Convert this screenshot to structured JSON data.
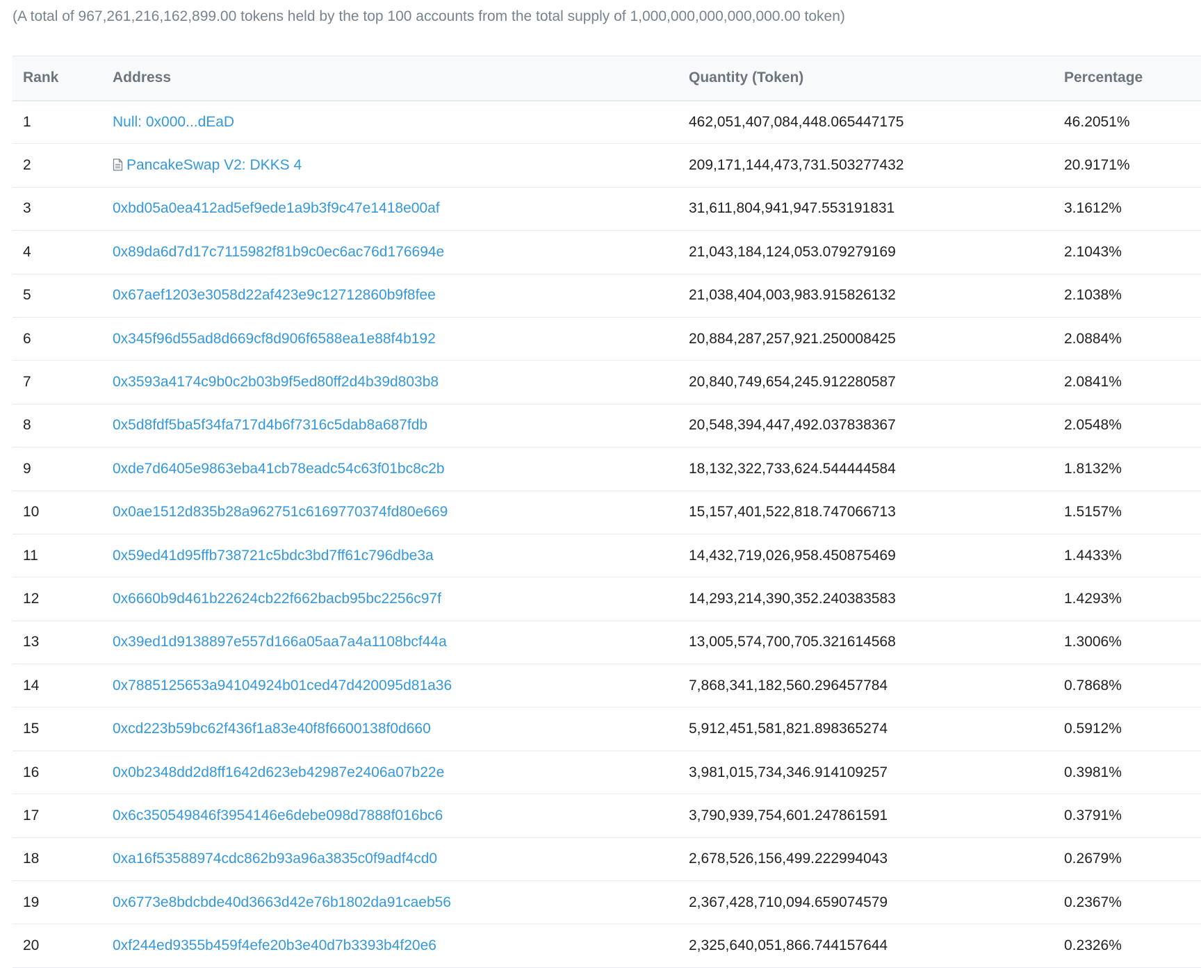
{
  "summary": "(A total of 967,261,216,162,899.00 tokens held by the top 100 accounts from the total supply of 1,000,000,000,000,000.00 token)",
  "table": {
    "headers": {
      "rank": "Rank",
      "address": "Address",
      "quantity": "Quantity (Token)",
      "percentage": "Percentage"
    },
    "rows": [
      {
        "rank": "1",
        "address": "Null: 0x000...dEaD",
        "is_contract": false,
        "quantity": "462,051,407,084,448.065447175",
        "percentage": "46.2051%"
      },
      {
        "rank": "2",
        "address": "PancakeSwap V2: DKKS 4",
        "is_contract": true,
        "icon": "contract-document-icon",
        "quantity": "209,171,144,473,731.503277432",
        "percentage": "20.9171%"
      },
      {
        "rank": "3",
        "address": "0xbd05a0ea412ad5ef9ede1a9b3f9c47e1418e00af",
        "is_contract": false,
        "quantity": "31,611,804,941,947.553191831",
        "percentage": "3.1612%"
      },
      {
        "rank": "4",
        "address": "0x89da6d7d17c7115982f81b9c0ec6ac76d176694e",
        "is_contract": false,
        "quantity": "21,043,184,124,053.079279169",
        "percentage": "2.1043%"
      },
      {
        "rank": "5",
        "address": "0x67aef1203e3058d22af423e9c12712860b9f8fee",
        "is_contract": false,
        "quantity": "21,038,404,003,983.915826132",
        "percentage": "2.1038%"
      },
      {
        "rank": "6",
        "address": "0x345f96d55ad8d669cf8d906f6588ea1e88f4b192",
        "is_contract": false,
        "quantity": "20,884,287,257,921.250008425",
        "percentage": "2.0884%"
      },
      {
        "rank": "7",
        "address": "0x3593a4174c9b0c2b03b9f5ed80ff2d4b39d803b8",
        "is_contract": false,
        "quantity": "20,840,749,654,245.912280587",
        "percentage": "2.0841%"
      },
      {
        "rank": "8",
        "address": "0x5d8fdf5ba5f34fa717d4b6f7316c5dab8a687fdb",
        "is_contract": false,
        "quantity": "20,548,394,447,492.037838367",
        "percentage": "2.0548%"
      },
      {
        "rank": "9",
        "address": "0xde7d6405e9863eba41cb78eadc54c63f01bc8c2b",
        "is_contract": false,
        "quantity": "18,132,322,733,624.544444584",
        "percentage": "1.8132%"
      },
      {
        "rank": "10",
        "address": "0x0ae1512d835b28a962751c6169770374fd80e669",
        "is_contract": false,
        "quantity": "15,157,401,522,818.747066713",
        "percentage": "1.5157%"
      },
      {
        "rank": "11",
        "address": "0x59ed41d95ffb738721c5bdc3bd7ff61c796dbe3a",
        "is_contract": false,
        "quantity": "14,432,719,026,958.450875469",
        "percentage": "1.4433%"
      },
      {
        "rank": "12",
        "address": "0x6660b9d461b22624cb22f662bacb95bc2256c97f",
        "is_contract": false,
        "quantity": "14,293,214,390,352.240383583",
        "percentage": "1.4293%"
      },
      {
        "rank": "13",
        "address": "0x39ed1d9138897e557d166a05aa7a4a1108bcf44a",
        "is_contract": false,
        "quantity": "13,005,574,700,705.321614568",
        "percentage": "1.3006%"
      },
      {
        "rank": "14",
        "address": "0x7885125653a94104924b01ced47d420095d81a36",
        "is_contract": false,
        "quantity": "7,868,341,182,560.296457784",
        "percentage": "0.7868%"
      },
      {
        "rank": "15",
        "address": "0xcd223b59bc62f436f1a83e40f8f6600138f0d660",
        "is_contract": false,
        "quantity": "5,912,451,581,821.898365274",
        "percentage": "0.5912%"
      },
      {
        "rank": "16",
        "address": "0x0b2348dd2d8ff1642d623eb42987e2406a07b22e",
        "is_contract": false,
        "quantity": "3,981,015,734,346.914109257",
        "percentage": "0.3981%"
      },
      {
        "rank": "17",
        "address": "0x6c350549846f3954146e6debe098d7888f016bc6",
        "is_contract": false,
        "quantity": "3,790,939,754,601.247861591",
        "percentage": "0.3791%"
      },
      {
        "rank": "18",
        "address": "0xa16f53588974cdc862b93a96a3835c0f9adf4cd0",
        "is_contract": false,
        "quantity": "2,678,526,156,499.222994043",
        "percentage": "0.2679%"
      },
      {
        "rank": "19",
        "address": "0x6773e8bdcbde40d3663d42e76b1802da91caeb56",
        "is_contract": false,
        "quantity": "2,367,428,710,094.659074579",
        "percentage": "0.2367%"
      },
      {
        "rank": "20",
        "address": "0xf244ed9355b459f4efe20b3e40d7b3393b4f20e6",
        "is_contract": false,
        "quantity": "2,325,640,051,866.744157644",
        "percentage": "0.2326%"
      }
    ]
  },
  "colors": {
    "link": "#3498db",
    "muted": "#77838f",
    "border": "#e7eaf3",
    "header_bg": "#f8f9fa"
  }
}
